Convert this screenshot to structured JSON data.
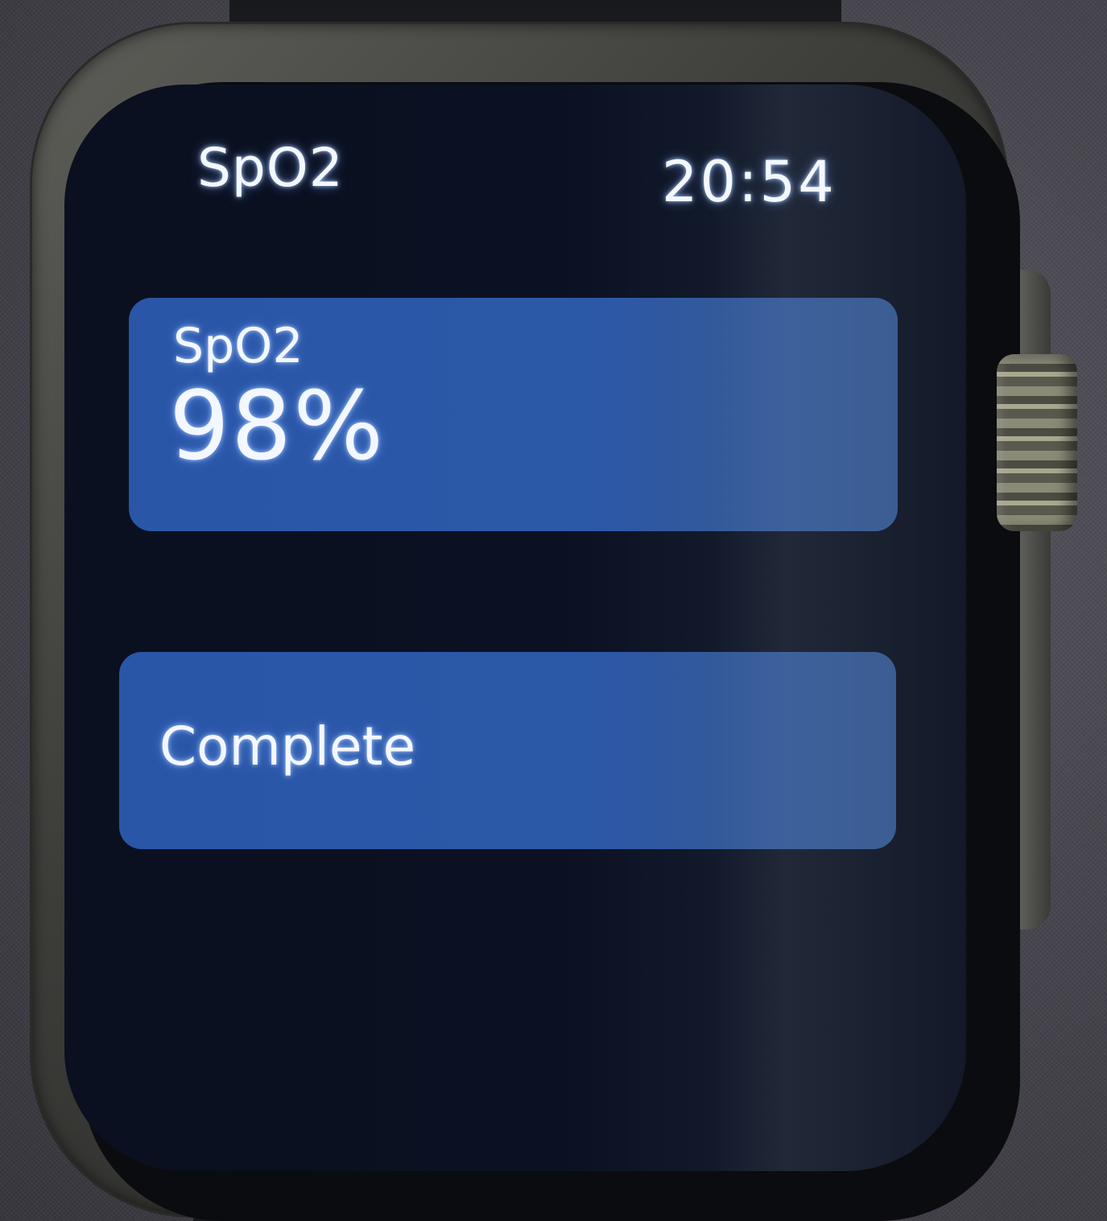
{
  "header": {
    "title": "SpO2",
    "time": "20:54"
  },
  "reading": {
    "label": "SpO2",
    "value": "98%"
  },
  "status": {
    "label": "Complete"
  },
  "colors": {
    "screen_bg": "#0b1122",
    "card_bg": "#2b57a8",
    "text": "#f3f7ff"
  }
}
